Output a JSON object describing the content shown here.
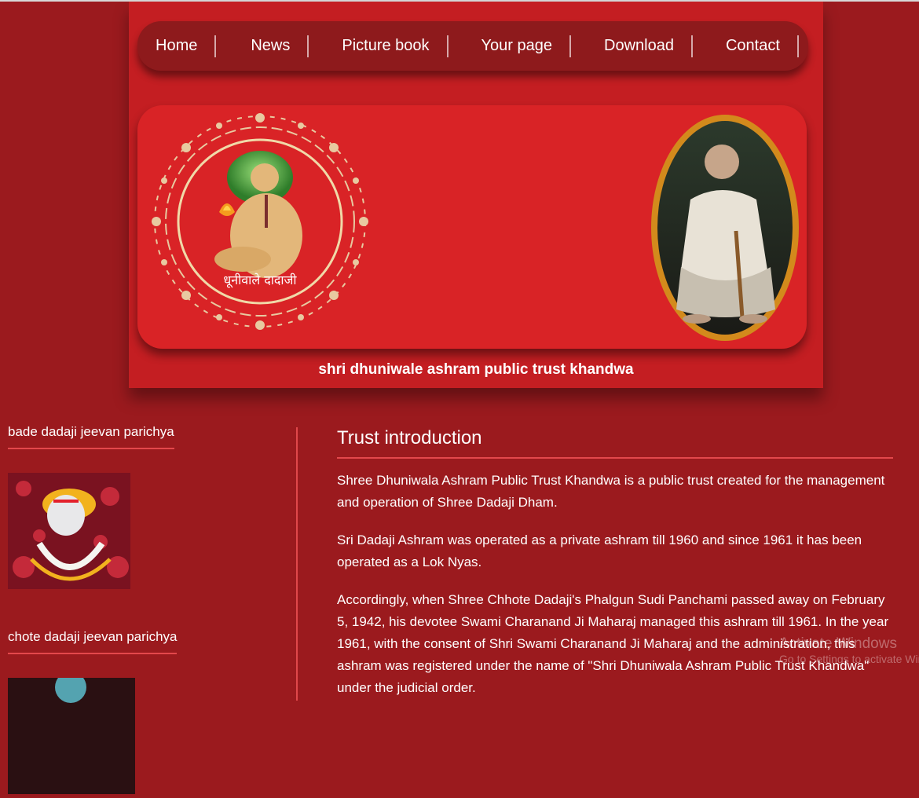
{
  "nav": {
    "items": [
      {
        "label": "Home"
      },
      {
        "label": "News"
      },
      {
        "label": "Picture book"
      },
      {
        "label": "Your page"
      },
      {
        "label": "Download"
      },
      {
        "label": "Contact"
      }
    ]
  },
  "header": {
    "trust_title": "shri dhuniwale ashram public trust khandwa",
    "logo_caption": "धूनीवाले दादाजी"
  },
  "sidebar": {
    "items": [
      {
        "heading": "bade dadaji jeevan parichya"
      },
      {
        "heading": "chote dadaji jeevan parichya"
      }
    ]
  },
  "main": {
    "title": "Trust introduction",
    "paragraphs": [
      "Shree Dhuniwala Ashram Public Trust Khandwa is a public trust created for the management and operation of Shree Dadaji Dham.",
      "Sri Dadaji Ashram was operated as a private ashram till 1960 and since 1961 it has been operated as a Lok Nyas.",
      "Accordingly, when Shree Chhote Dadaji's Phalgun Sudi Panchami passed away on February 5, 1942, his devotee Swami Charanand Ji Maharaj managed this ashram till 1961. In the year 1961, with the consent of Shri Swami Charanand Ji Maharaj and the administration, this ashram was registered under the name of \"Shri Dhuniwala Ashram Public Trust Khandwa\" under the judicial order."
    ]
  },
  "watermark": {
    "line1": "Activate Windows",
    "line2": "Go to Settings to activate Windows."
  },
  "colors": {
    "page_bg": "#9b1a1e",
    "header_bg": "#c41e22",
    "nav_bg": "#8e1a1c",
    "banner_bg": "#d92326",
    "accent_line": "#e3474b"
  }
}
